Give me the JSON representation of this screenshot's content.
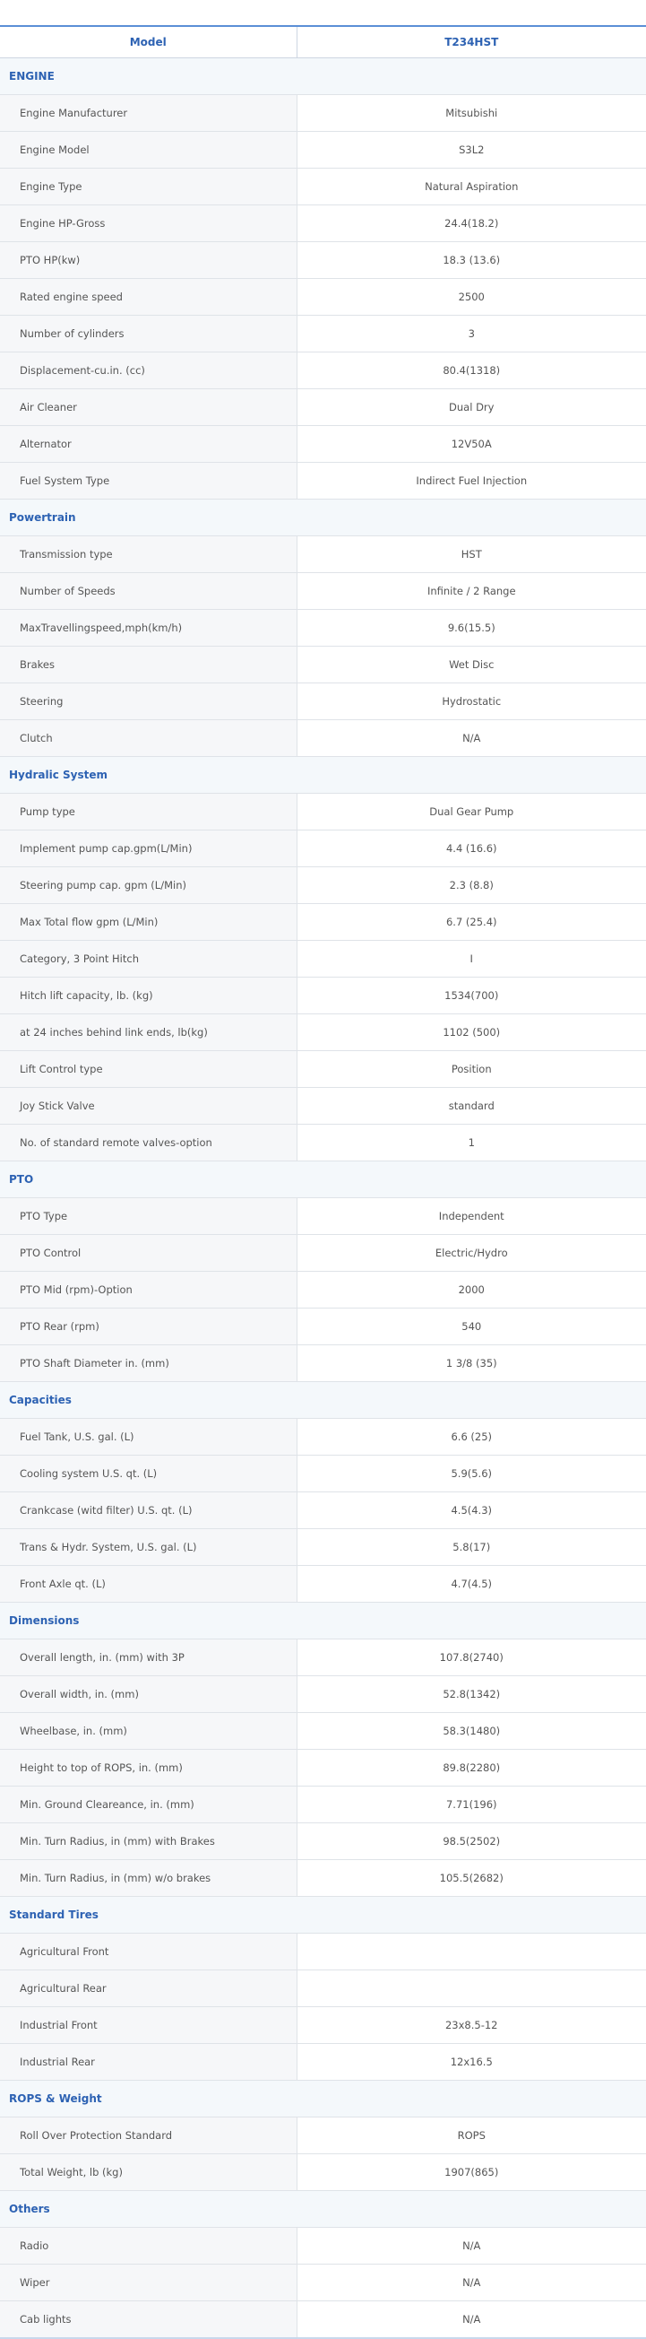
{
  "header": {
    "model_label": "Model",
    "model_value": "T234HST"
  },
  "sections": [
    {
      "title": "ENGINE",
      "rows": [
        {
          "label": "Engine Manufacturer",
          "value": "Mitsubishi"
        },
        {
          "label": "Engine Model",
          "value": "S3L2"
        },
        {
          "label": "Engine Type",
          "value": "Natural Aspiration"
        },
        {
          "label": "Engine HP-Gross",
          "value": "24.4(18.2)"
        },
        {
          "label": "PTO HP(kw)",
          "value": "18.3 (13.6)"
        },
        {
          "label": "Rated engine speed",
          "value": "2500"
        },
        {
          "label": "Number of cylinders",
          "value": "3"
        },
        {
          "label": "Displacement-cu.in. (cc)",
          "value": "80.4(1318)"
        },
        {
          "label": "Air Cleaner",
          "value": "Dual Dry"
        },
        {
          "label": "Alternator",
          "value": "12V50A"
        },
        {
          "label": "Fuel System Type",
          "value": "Indirect Fuel Injection"
        }
      ]
    },
    {
      "title": "Powertrain",
      "rows": [
        {
          "label": "Transmission type",
          "value": "HST"
        },
        {
          "label": "Number of Speeds",
          "value": "Infinite / 2 Range"
        },
        {
          "label": "MaxTravellingspeed,mph(km/h)",
          "value": "9.6(15.5)"
        },
        {
          "label": "Brakes",
          "value": "Wet Disc"
        },
        {
          "label": "Steering",
          "value": "Hydrostatic"
        },
        {
          "label": "Clutch",
          "value": "N/A"
        }
      ]
    },
    {
      "title": "Hydralic System",
      "rows": [
        {
          "label": "Pump type",
          "value": "Dual Gear Pump"
        },
        {
          "label": "Implement pump cap.gpm(L/Min)",
          "value": "4.4 (16.6)"
        },
        {
          "label": "Steering pump cap. gpm (L/Min)",
          "value": "2.3 (8.8)"
        },
        {
          "label": "Max Total flow gpm (L/Min)",
          "value": "6.7 (25.4)"
        },
        {
          "label": "Category, 3 Point Hitch",
          "value": "I"
        },
        {
          "label": "Hitch lift capacity, lb. (kg)",
          "value": "1534(700)"
        },
        {
          "label": "at 24 inches behind link ends, lb(kg)",
          "value": "1102 (500)"
        },
        {
          "label": "Lift Control type",
          "value": "Position"
        },
        {
          "label": "Joy Stick Valve",
          "value": "standard"
        },
        {
          "label": "No. of standard remote valves-option",
          "value": "1"
        }
      ]
    },
    {
      "title": "PTO",
      "rows": [
        {
          "label": "PTO Type",
          "value": "Independent"
        },
        {
          "label": "PTO Control",
          "value": "Electric/Hydro"
        },
        {
          "label": "PTO Mid (rpm)-Option",
          "value": "2000"
        },
        {
          "label": "PTO Rear (rpm)",
          "value": "540"
        },
        {
          "label": "PTO Shaft Diameter in. (mm)",
          "value": "1 3/8 (35)"
        }
      ]
    },
    {
      "title": "Capacities",
      "rows": [
        {
          "label": "Fuel Tank, U.S. gal. (L)",
          "value": "6.6 (25)"
        },
        {
          "label": "Cooling system U.S. qt. (L)",
          "value": "5.9(5.6)"
        },
        {
          "label": "Crankcase (witd filter) U.S. qt. (L)",
          "value": "4.5(4.3)"
        },
        {
          "label": "Trans & Hydr. System, U.S. gal. (L)",
          "value": "5.8(17)"
        },
        {
          "label": "Front Axle qt. (L)",
          "value": "4.7(4.5)"
        }
      ]
    },
    {
      "title": "Dimensions",
      "rows": [
        {
          "label": "Overall length, in. (mm) with 3P",
          "value": "107.8(2740)"
        },
        {
          "label": "Overall width, in. (mm)",
          "value": "52.8(1342)"
        },
        {
          "label": "Wheelbase, in. (mm)",
          "value": "58.3(1480)"
        },
        {
          "label": "Height to top of ROPS, in. (mm)",
          "value": "89.8(2280)"
        },
        {
          "label": "Min. Ground Cleareance, in. (mm)",
          "value": "7.71(196)"
        },
        {
          "label": "Min. Turn Radius, in (mm) with Brakes",
          "value": "98.5(2502)"
        },
        {
          "label": "Min. Turn Radius, in (mm) w/o brakes",
          "value": "105.5(2682)"
        }
      ]
    },
    {
      "title": "Standard Tires",
      "rows": [
        {
          "label": "Agricultural Front",
          "value": ""
        },
        {
          "label": "Agricultural Rear",
          "value": ""
        },
        {
          "label": "Industrial Front",
          "value": "23x8.5-12"
        },
        {
          "label": "Industrial Rear",
          "value": "12x16.5"
        }
      ]
    },
    {
      "title": "ROPS & Weight",
      "rows": [
        {
          "label": "Roll Over Protection Standard",
          "value": "ROPS"
        },
        {
          "label": "Total Weight, lb (kg)",
          "value": "1907(865)"
        }
      ]
    },
    {
      "title": "Others",
      "rows": [
        {
          "label": "Radio",
          "value": "N/A"
        },
        {
          "label": "Wiper",
          "value": "N/A"
        },
        {
          "label": "Cab lights",
          "value": "N/A"
        }
      ]
    }
  ]
}
